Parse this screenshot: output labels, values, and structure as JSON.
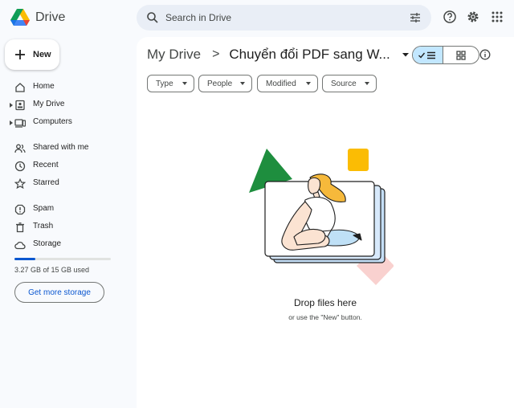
{
  "app": {
    "name": "Drive"
  },
  "search": {
    "placeholder": "Search in Drive"
  },
  "new_button": {
    "label": "New"
  },
  "sidebar": {
    "items": [
      {
        "label": "Home"
      },
      {
        "label": "My Drive"
      },
      {
        "label": "Computers"
      },
      {
        "label": "Shared with me"
      },
      {
        "label": "Recent"
      },
      {
        "label": "Starred"
      },
      {
        "label": "Spam"
      },
      {
        "label": "Trash"
      },
      {
        "label": "Storage"
      }
    ],
    "storage_used_fraction": 0.218,
    "storage_text": "3.27 GB of 15 GB used",
    "get_storage_label": "Get more storage"
  },
  "breadcrumb": {
    "root": "My Drive",
    "separator": ">",
    "current": "Chuyển đổi PDF sang W..."
  },
  "filters": [
    {
      "label": "Type"
    },
    {
      "label": "People"
    },
    {
      "label": "Modified"
    },
    {
      "label": "Source"
    }
  ],
  "empty_state": {
    "title": "Drop files here",
    "subtitle": "or use the \"New\" button."
  },
  "colors": {
    "accent": "#0b57d0",
    "toggle_selected": "#c2e7ff",
    "search_bg": "#e9eef6",
    "page_bg": "#f8fafd"
  }
}
